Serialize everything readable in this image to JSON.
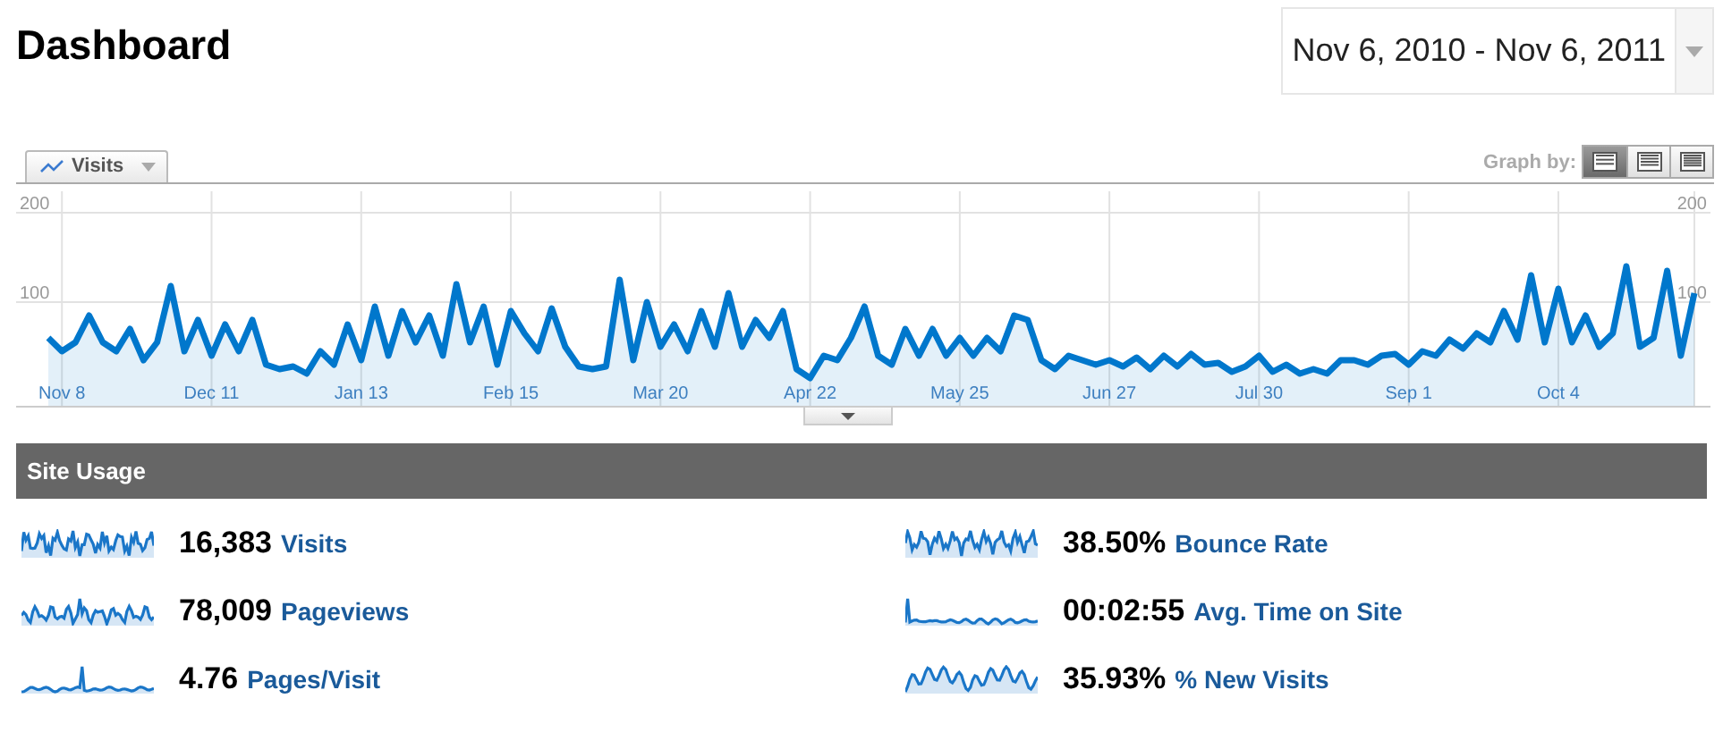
{
  "header": {
    "title": "Dashboard",
    "date_range": "Nov 6, 2010 - Nov 6, 2011"
  },
  "chart_toolbar": {
    "graph_by_label": "Graph by:",
    "graph_by_options": [
      {
        "selected": true
      },
      {
        "selected": false
      },
      {
        "selected": false
      }
    ]
  },
  "chart": {
    "chart_data": {
      "type": "area",
      "grid": true,
      "ylim": [
        0,
        200
      ],
      "yticks": [
        100,
        200
      ],
      "annotations": [
        "100",
        "200"
      ],
      "categories": [
        null,
        "Nov 8",
        null,
        null,
        null,
        null,
        null,
        null,
        null,
        null,
        null,
        null,
        "Dec 11",
        null,
        null,
        null,
        null,
        null,
        null,
        null,
        null,
        null,
        null,
        "Jan 13",
        null,
        null,
        null,
        null,
        null,
        null,
        null,
        null,
        null,
        null,
        "Feb 15",
        null,
        null,
        null,
        null,
        null,
        null,
        null,
        null,
        null,
        null,
        "Mar 20",
        null,
        null,
        null,
        null,
        null,
        null,
        null,
        null,
        null,
        null,
        "Apr 22",
        null,
        null,
        null,
        null,
        null,
        null,
        null,
        null,
        null,
        null,
        "May 25",
        null,
        null,
        null,
        null,
        null,
        null,
        null,
        null,
        null,
        null,
        "Jun 27",
        null,
        null,
        null,
        null,
        null,
        null,
        null,
        null,
        null,
        null,
        "Jul 30",
        null,
        null,
        null,
        null,
        null,
        null,
        null,
        null,
        null,
        null,
        "Sep 1",
        null,
        null,
        null,
        null,
        null,
        null,
        null,
        null,
        null,
        null,
        "Oct 4",
        null,
        null,
        null,
        null,
        null,
        null,
        null,
        null,
        null,
        null
      ],
      "series": [
        {
          "name": "Visits",
          "color": "#0077cc",
          "values": [
            60,
            45,
            55,
            85,
            55,
            45,
            70,
            35,
            55,
            118,
            45,
            80,
            40,
            75,
            45,
            80,
            30,
            25,
            28,
            20,
            45,
            30,
            75,
            35,
            95,
            40,
            90,
            55,
            85,
            40,
            120,
            55,
            95,
            30,
            90,
            65,
            45,
            93,
            50,
            28,
            25,
            28,
            125,
            35,
            100,
            50,
            75,
            45,
            90,
            50,
            110,
            50,
            80,
            60,
            90,
            25,
            15,
            40,
            35,
            60,
            95,
            40,
            30,
            70,
            40,
            70,
            40,
            60,
            40,
            60,
            45,
            85,
            80,
            35,
            25,
            40,
            35,
            30,
            35,
            28,
            38,
            25,
            40,
            28,
            42,
            30,
            32,
            22,
            28,
            40,
            22,
            30,
            20,
            25,
            20,
            35,
            35,
            30,
            40,
            42,
            30,
            45,
            40,
            58,
            48,
            65,
            55,
            90,
            58,
            130,
            55,
            115,
            55,
            85,
            50,
            65,
            140,
            50,
            60,
            135,
            40,
            110
          ]
        }
      ]
    }
  },
  "site_usage": {
    "title": "Site Usage",
    "metrics": [
      {
        "value": "16,383",
        "label": "Visits"
      },
      {
        "value": "38.50%",
        "label": "Bounce Rate"
      },
      {
        "value": "78,009",
        "label": "Pageviews"
      },
      {
        "value": "00:02:55",
        "label": "Avg. Time on Site"
      },
      {
        "value": "4.76",
        "label": "Pages/Visit"
      },
      {
        "value": "35.93%",
        "label": "% New Visits"
      }
    ]
  }
}
